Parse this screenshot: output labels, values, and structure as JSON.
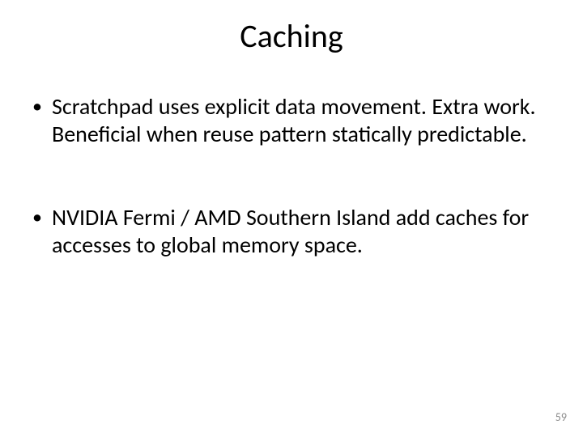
{
  "slide": {
    "title": "Caching",
    "bullets": [
      "Scratchpad uses explicit data movement. Extra work. Beneficial when reuse pattern statically predictable.",
      "NVIDIA Fermi / AMD Southern Island add caches for accesses to global memory space."
    ],
    "page_number": "59"
  }
}
